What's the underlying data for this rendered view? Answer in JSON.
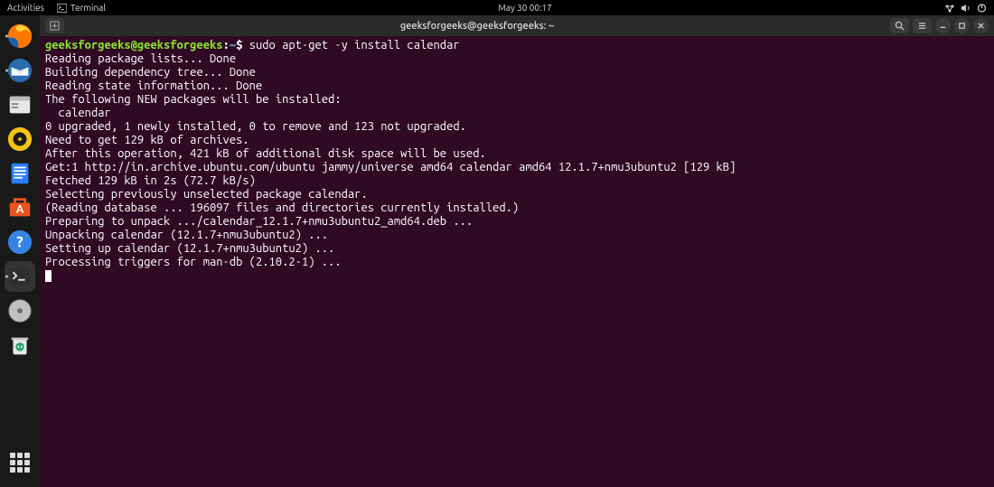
{
  "topbar": {
    "activities": "Activities",
    "app_label": "Terminal",
    "datetime": "May 30  00:17"
  },
  "window": {
    "title": "geeksforgeeks@geeksforgeeks: ~"
  },
  "prompt": {
    "userhost": "geeksforgeeks@geeksforgeeks",
    "path": "~",
    "symbol": "$",
    "command": "sudo apt-get -y install calendar"
  },
  "output": [
    "Reading package lists... Done",
    "Building dependency tree... Done",
    "Reading state information... Done",
    "The following NEW packages will be installed:",
    "  calendar",
    "0 upgraded, 1 newly installed, 0 to remove and 123 not upgraded.",
    "Need to get 129 kB of archives.",
    "After this operation, 421 kB of additional disk space will be used.",
    "Get:1 http://in.archive.ubuntu.com/ubuntu jammy/universe amd64 calendar amd64 12.1.7+nmu3ubuntu2 [129 kB]",
    "Fetched 129 kB in 2s (72.7 kB/s)",
    "Selecting previously unselected package calendar.",
    "(Reading database ... 196097 files and directories currently installed.)",
    "Preparing to unpack .../calendar_12.1.7+nmu3ubuntu2_amd64.deb ...",
    "Unpacking calendar (12.1.7+nmu3ubuntu2) ...",
    "Setting up calendar (12.1.7+nmu3ubuntu2) ...",
    "Processing triggers for man-db (2.10.2-1) ..."
  ]
}
